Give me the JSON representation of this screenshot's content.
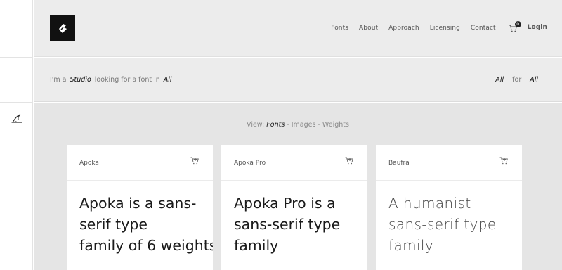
{
  "header": {
    "logo": "logo-icon",
    "nav": [
      "Fonts",
      "About",
      "Approach",
      "Licensing",
      "Contact"
    ],
    "cart_count": "0",
    "login": "Login"
  },
  "filter": {
    "prefix": "I'm a",
    "role": "Studio",
    "middle": "looking for a font in",
    "category": "All",
    "right_a": "All",
    "right_for": "for",
    "right_b": "All"
  },
  "view": {
    "label": "View:",
    "active": "Fonts",
    "sep1": " - ",
    "images": "Images",
    "sep2": " - ",
    "weights": "Weights"
  },
  "cards": [
    {
      "name": "Apoka",
      "lines": [
        "Apoka is a sans-",
        "serif type",
        "family of 6 weights"
      ]
    },
    {
      "name": "Apoka Pro",
      "lines": [
        "Apoka Pro is a",
        "sans-serif type",
        "family"
      ]
    },
    {
      "name": "Baufra",
      "lines": [
        "A humanist",
        "sans-serif type",
        "family"
      ]
    }
  ],
  "colors": {
    "background": "#ececec",
    "content": "#e5e5e5",
    "accent": "#111111"
  }
}
